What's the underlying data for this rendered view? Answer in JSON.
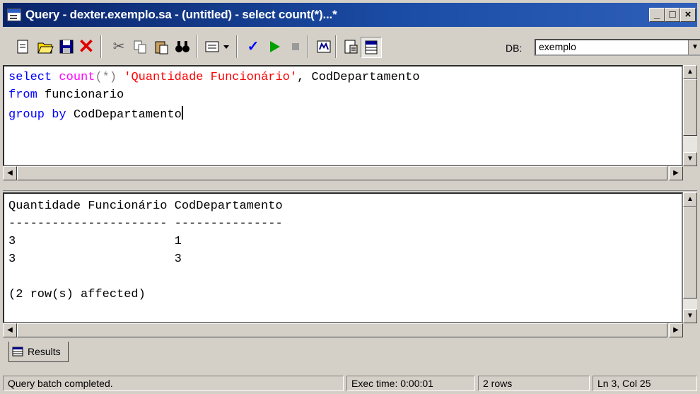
{
  "window": {
    "title": "Query - dexter.exemplo.sa - (untitled) - select count(*)...*",
    "minimize": "_",
    "maximize": "□",
    "close": "×"
  },
  "toolbar": {
    "db_label": "DB:",
    "db_value": "exemplo",
    "icons": [
      "new-query-icon",
      "open-icon",
      "save-icon",
      "delete-icon",
      "cut-icon",
      "copy-icon",
      "paste-icon",
      "find-icon",
      "results-mode-icon",
      "parse-icon",
      "execute-icon",
      "stop-icon",
      "display-plan-icon",
      "properties-icon",
      "results-grid-icon"
    ]
  },
  "editor": {
    "line1": {
      "kw1": "select",
      "fn": "count",
      "paren": "(*)",
      "str": "'Quantidade Funcionário'",
      "rest": ", CodDepartamento"
    },
    "line2": {
      "kw": "from",
      "rest": " funcionario"
    },
    "line3": {
      "kw": "group by",
      "rest": " CodDepartamento"
    }
  },
  "results": {
    "header": "Quantidade Funcionário CodDepartamento",
    "divider": "---------------------- ---------------",
    "rows": [
      "3                      1",
      "3                      3"
    ],
    "footer": "(2 row(s) affected)"
  },
  "tabs": {
    "results_label": "Results"
  },
  "statusbar": {
    "message": "Query batch completed.",
    "exec_time": "Exec time: 0:00:01",
    "rows": "2 rows",
    "position": "Ln 3, Col 25"
  }
}
